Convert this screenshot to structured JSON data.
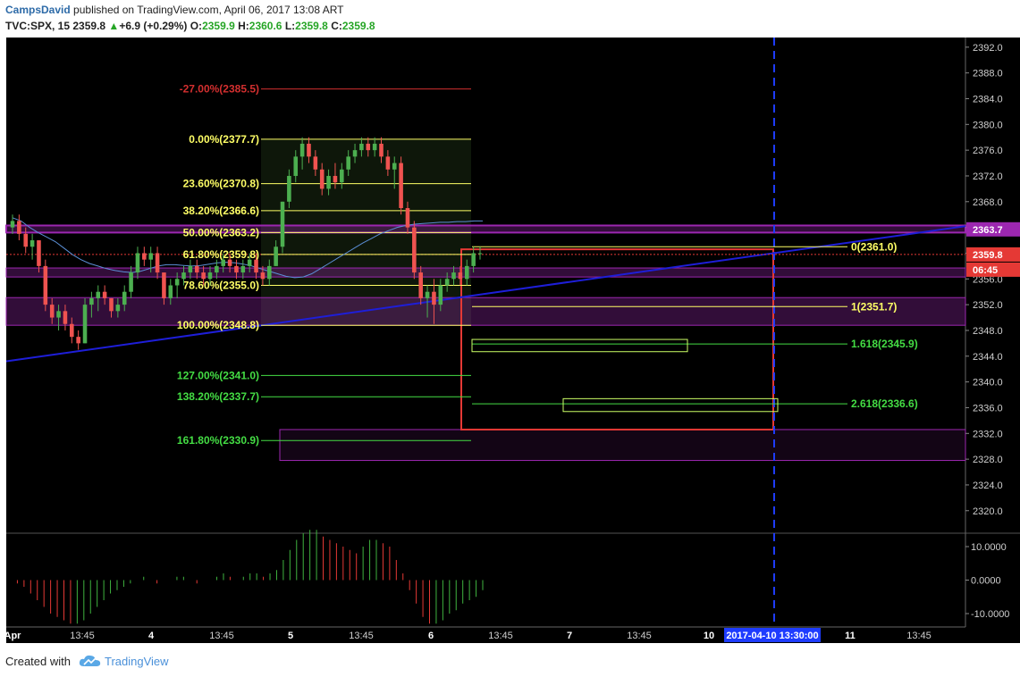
{
  "header": {
    "author": "CampsDavid",
    "published_text": "published on TradingView.com, April 06, 2017 13:08 ART",
    "symbol": "TVC:SPX, 15",
    "last": "2359.8",
    "change_arrow": "▲",
    "change": "+6.9 (+0.29%)",
    "o_label": "O:",
    "o_value": "2359.9",
    "h_label": "H:",
    "h_value": "2360.6",
    "l_label": "L:",
    "l_value": "2359.8",
    "c_label": "C:",
    "c_value": "2359.8"
  },
  "footer": {
    "created_with": "Created with",
    "brand": "TradingView"
  },
  "colors": {
    "background": "#000000",
    "bull": "#4caf50",
    "bear": "#ef5350",
    "fib_yellow": "#ffff66",
    "fib_green": "#44dd44",
    "fib_red": "#d32f2f",
    "trendline": "#1e1ed8",
    "zone": "#9c27b0",
    "time_marker": "#1e3cff",
    "red_box": "#e53935"
  },
  "chart_data": {
    "type": "candlestick",
    "symbol": "TVC:SPX",
    "interval": "15",
    "ylim": [
      2316.5,
      2393.5
    ],
    "y_ticks": [
      "2392.0",
      "2388.0",
      "2384.0",
      "2380.0",
      "2376.0",
      "2372.0",
      "2368.0",
      "2364.0",
      "2360.0",
      "2356.0",
      "2352.0",
      "2348.0",
      "2344.0",
      "2340.0",
      "2336.0",
      "2332.0",
      "2328.0",
      "2324.0",
      "2320.0"
    ],
    "x_ticks": [
      "Apr",
      "13:45",
      "4",
      "13:45",
      "5",
      "13:45",
      "6",
      "13:45",
      "7",
      "13:45",
      "10",
      "11",
      "13:45"
    ],
    "x_ticks_bold": [
      "Apr",
      "4",
      "5",
      "6",
      "7",
      "10",
      "11"
    ],
    "time_marker_label": "2017-04-10 13:30:00",
    "price_badges": [
      {
        "label": "2363.7",
        "value": 2363.7,
        "color": "#9c27b0"
      },
      {
        "label": "2359.8",
        "value": 2359.8,
        "color": "#e53935"
      },
      {
        "label": "06:45",
        "value": 2358.0,
        "color": "#e53935"
      }
    ],
    "candles": [
      {
        "o": 2364,
        "h": 2366,
        "l": 2363,
        "c": 2365
      },
      {
        "o": 2365,
        "h": 2366,
        "l": 2362,
        "c": 2363
      },
      {
        "o": 2363,
        "h": 2364,
        "l": 2360,
        "c": 2361
      },
      {
        "o": 2361,
        "h": 2363,
        "l": 2359,
        "c": 2362
      },
      {
        "o": 2362,
        "h": 2362,
        "l": 2357,
        "c": 2358
      },
      {
        "o": 2358,
        "h": 2359,
        "l": 2351,
        "c": 2352
      },
      {
        "o": 2352,
        "h": 2353,
        "l": 2349,
        "c": 2350
      },
      {
        "o": 2350,
        "h": 2352,
        "l": 2348,
        "c": 2351
      },
      {
        "o": 2351,
        "h": 2352,
        "l": 2348,
        "c": 2349
      },
      {
        "o": 2349,
        "h": 2350,
        "l": 2346,
        "c": 2347
      },
      {
        "o": 2347,
        "h": 2348,
        "l": 2345,
        "c": 2346
      },
      {
        "o": 2346,
        "h": 2353,
        "l": 2346,
        "c": 2352
      },
      {
        "o": 2352,
        "h": 2354,
        "l": 2350,
        "c": 2353
      },
      {
        "o": 2353,
        "h": 2355,
        "l": 2351,
        "c": 2354
      },
      {
        "o": 2354,
        "h": 2355,
        "l": 2352,
        "c": 2353
      },
      {
        "o": 2353,
        "h": 2353,
        "l": 2350,
        "c": 2351
      },
      {
        "o": 2351,
        "h": 2353,
        "l": 2350,
        "c": 2352
      },
      {
        "o": 2352,
        "h": 2355,
        "l": 2351,
        "c": 2354
      },
      {
        "o": 2354,
        "h": 2358,
        "l": 2353,
        "c": 2357
      },
      {
        "o": 2357,
        "h": 2361,
        "l": 2356,
        "c": 2360
      },
      {
        "o": 2360,
        "h": 2361,
        "l": 2358,
        "c": 2359
      },
      {
        "o": 2359,
        "h": 2361,
        "l": 2357,
        "c": 2360
      },
      {
        "o": 2360,
        "h": 2361,
        "l": 2356,
        "c": 2357
      },
      {
        "o": 2357,
        "h": 2357,
        "l": 2352,
        "c": 2353
      },
      {
        "o": 2353,
        "h": 2356,
        "l": 2352,
        "c": 2355
      },
      {
        "o": 2355,
        "h": 2357,
        "l": 2353,
        "c": 2356
      },
      {
        "o": 2356,
        "h": 2358,
        "l": 2355,
        "c": 2357
      },
      {
        "o": 2357,
        "h": 2359,
        "l": 2356,
        "c": 2358
      },
      {
        "o": 2358,
        "h": 2359,
        "l": 2356,
        "c": 2357
      },
      {
        "o": 2357,
        "h": 2358,
        "l": 2355,
        "c": 2356
      },
      {
        "o": 2356,
        "h": 2358,
        "l": 2355,
        "c": 2357
      },
      {
        "o": 2357,
        "h": 2359,
        "l": 2356,
        "c": 2358
      },
      {
        "o": 2358,
        "h": 2360,
        "l": 2357,
        "c": 2359
      },
      {
        "o": 2359,
        "h": 2360,
        "l": 2357,
        "c": 2358
      },
      {
        "o": 2358,
        "h": 2359,
        "l": 2356,
        "c": 2357
      },
      {
        "o": 2357,
        "h": 2359,
        "l": 2356,
        "c": 2358
      },
      {
        "o": 2358,
        "h": 2360,
        "l": 2357,
        "c": 2359
      },
      {
        "o": 2359,
        "h": 2360,
        "l": 2356,
        "c": 2357
      },
      {
        "o": 2357,
        "h": 2358,
        "l": 2355,
        "c": 2356
      },
      {
        "o": 2356,
        "h": 2359,
        "l": 2355,
        "c": 2358
      },
      {
        "o": 2358,
        "h": 2362,
        "l": 2358,
        "c": 2361
      },
      {
        "o": 2361,
        "h": 2368,
        "l": 2360,
        "c": 2368
      },
      {
        "o": 2368,
        "h": 2373,
        "l": 2367,
        "c": 2372
      },
      {
        "o": 2372,
        "h": 2376,
        "l": 2371,
        "c": 2375
      },
      {
        "o": 2375,
        "h": 2378,
        "l": 2373,
        "c": 2377
      },
      {
        "o": 2377,
        "h": 2378,
        "l": 2374,
        "c": 2375
      },
      {
        "o": 2375,
        "h": 2376,
        "l": 2372,
        "c": 2373
      },
      {
        "o": 2373,
        "h": 2374,
        "l": 2369,
        "c": 2370
      },
      {
        "o": 2370,
        "h": 2373,
        "l": 2369,
        "c": 2372
      },
      {
        "o": 2372,
        "h": 2374,
        "l": 2370,
        "c": 2371
      },
      {
        "o": 2371,
        "h": 2374,
        "l": 2370,
        "c": 2373
      },
      {
        "o": 2373,
        "h": 2376,
        "l": 2372,
        "c": 2375
      },
      {
        "o": 2375,
        "h": 2377,
        "l": 2374,
        "c": 2376
      },
      {
        "o": 2376,
        "h": 2378,
        "l": 2375,
        "c": 2377
      },
      {
        "o": 2377,
        "h": 2378,
        "l": 2375,
        "c": 2376
      },
      {
        "o": 2376,
        "h": 2378,
        "l": 2375,
        "c": 2377
      },
      {
        "o": 2377,
        "h": 2378,
        "l": 2374,
        "c": 2375
      },
      {
        "o": 2375,
        "h": 2376,
        "l": 2372,
        "c": 2373
      },
      {
        "o": 2373,
        "h": 2375,
        "l": 2370,
        "c": 2374
      },
      {
        "o": 2374,
        "h": 2375,
        "l": 2366,
        "c": 2367
      },
      {
        "o": 2367,
        "h": 2368,
        "l": 2363,
        "c": 2364
      },
      {
        "o": 2364,
        "h": 2365,
        "l": 2356,
        "c": 2357
      },
      {
        "o": 2357,
        "h": 2358,
        "l": 2352,
        "c": 2353
      },
      {
        "o": 2353,
        "h": 2355,
        "l": 2350,
        "c": 2354
      },
      {
        "o": 2354,
        "h": 2356,
        "l": 2349,
        "c": 2352
      },
      {
        "o": 2352,
        "h": 2356,
        "l": 2351,
        "c": 2355
      },
      {
        "o": 2355,
        "h": 2357,
        "l": 2354,
        "c": 2356
      },
      {
        "o": 2356,
        "h": 2358,
        "l": 2355,
        "c": 2357
      },
      {
        "o": 2357,
        "h": 2358,
        "l": 2355,
        "c": 2356
      },
      {
        "o": 2356,
        "h": 2359,
        "l": 2355,
        "c": 2358
      },
      {
        "o": 2358,
        "h": 2361,
        "l": 2357,
        "c": 2360
      },
      {
        "o": 2360,
        "h": 2361,
        "l": 2359,
        "c": 2360
      }
    ],
    "moving_average": [
      2365.5,
      2365,
      2364,
      2363.2,
      2362.5,
      2361.8,
      2360.8,
      2359.8,
      2359,
      2358.4,
      2358,
      2357.6,
      2357.3,
      2357.1,
      2357,
      2357.2,
      2357.6,
      2358,
      2358.2,
      2358.2,
      2358.1,
      2358,
      2358.1,
      2358.3,
      2358.5,
      2358.6,
      2358.5,
      2358.3,
      2358,
      2357.6,
      2357.2,
      2356.8,
      2356.4,
      2356.2,
      2356.3,
      2356.8,
      2357.6,
      2358.4,
      2359.2,
      2360,
      2360.8,
      2361.6,
      2362.3,
      2363,
      2363.5,
      2364,
      2364.3,
      2364.5,
      2364.6,
      2364.7,
      2364.8,
      2364.8,
      2364.9,
      2364.9,
      2365,
      2365
    ],
    "fib_retracement": {
      "levels": [
        {
          "label": "-27.00%(2385.5)",
          "price": 2385.5,
          "color": "#d32f2f"
        },
        {
          "label": "0.00%(2377.7)",
          "price": 2377.7,
          "color": "#ffff66"
        },
        {
          "label": "23.60%(2370.8)",
          "price": 2370.8,
          "color": "#ffff66"
        },
        {
          "label": "38.20%(2366.6)",
          "price": 2366.6,
          "color": "#ffff66"
        },
        {
          "label": "50.00%(2363.2)",
          "price": 2363.2,
          "color": "#ffff66"
        },
        {
          "label": "61.80%(2359.8)",
          "price": 2359.8,
          "color": "#ffff66"
        },
        {
          "label": "78.60%(2355.0)",
          "price": 2355.0,
          "color": "#ffff66"
        },
        {
          "label": "100.00%(2348.8)",
          "price": 2348.8,
          "color": "#ffff66"
        },
        {
          "label": "127.00%(2341.0)",
          "price": 2341.0,
          "color": "#44dd44"
        },
        {
          "label": "138.20%(2337.7)",
          "price": 2337.7,
          "color": "#44dd44"
        },
        {
          "label": "161.80%(2330.9)",
          "price": 2330.9,
          "color": "#44dd44"
        }
      ]
    },
    "fib_extension": {
      "levels": [
        {
          "label": "0(2361.0)",
          "price": 2361.0,
          "color": "#ffff66"
        },
        {
          "label": "1(2351.7)",
          "price": 2351.7,
          "color": "#ffff66"
        },
        {
          "label": "1.618(2345.9)",
          "price": 2345.9,
          "color": "#44dd44"
        },
        {
          "label": "2.618(2336.6)",
          "price": 2336.6,
          "color": "#44dd44"
        }
      ]
    },
    "zones": [
      {
        "from": 2363.2,
        "to": 2364.3
      },
      {
        "from": 2356.3,
        "to": 2357.7
      },
      {
        "from": 2348.8,
        "to": 2353.1
      },
      {
        "from": 2327.8,
        "to": 2332.6
      }
    ],
    "macd_ticks": [
      "10.0000",
      "0.0000",
      "-10.0000"
    ],
    "macd_ylim": [
      -14,
      14
    ],
    "macd_histogram": [
      0,
      -1,
      -2,
      -4,
      -6,
      -8,
      -10,
      -11,
      -12,
      -13,
      -13,
      -12,
      -10,
      -8,
      -6,
      -4,
      -3,
      -2,
      -1,
      0,
      1,
      0,
      -1,
      0,
      0,
      1,
      1,
      0,
      -1,
      0,
      0,
      1,
      2,
      1,
      0,
      1,
      2,
      2,
      1,
      2,
      3,
      6,
      9,
      12,
      14,
      15,
      15,
      13,
      12,
      11,
      10,
      9,
      8,
      10,
      12,
      12,
      11,
      10,
      6,
      2,
      -3,
      -7,
      -11,
      -13,
      -13,
      -12,
      -10,
      -9,
      -7,
      -6,
      -5,
      -3
    ]
  }
}
